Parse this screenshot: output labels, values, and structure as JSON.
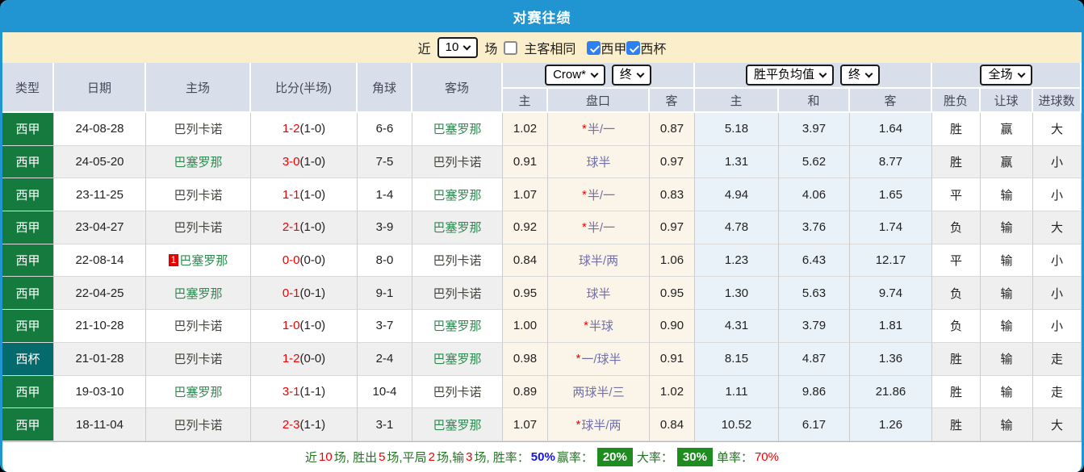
{
  "title": "对赛往绩",
  "colors": {
    "titlebar": "#2095d2",
    "filterbar": "#fbeecb",
    "league_badge": "#147a3d",
    "cup_badge": "#046a6c",
    "checked_checkbox": "#2d7ff2",
    "summary_badge": "#1f8c1f",
    "avg_bg": "#e8f2f8",
    "odds_bg": "#fbf4e8"
  },
  "filter": {
    "near_label": "近",
    "count_value": "10",
    "games_label": "场",
    "same_venue_label": "主客相同",
    "same_venue_checked": false,
    "league_label": "西甲",
    "league_checked": true,
    "cup_label": "西杯",
    "cup_checked": true
  },
  "header": {
    "type": "类型",
    "date": "日期",
    "home": "主场",
    "score": "比分(半场)",
    "corner": "角球",
    "away": "客场",
    "odds_source_select": "Crow*",
    "odds_final_select": "终",
    "avg_select": "胜平负均值",
    "avg_final_select": "终",
    "scope_select": "全场",
    "sub": [
      "主",
      "盘口",
      "客",
      "主",
      "和",
      "客",
      "胜负",
      "让球",
      "进球数"
    ]
  },
  "rows": [
    {
      "type": "西甲",
      "tcls": "league",
      "date": "24-08-28",
      "home": "巴列卡诺",
      "homeGreen": false,
      "badge": "",
      "score": "1-2",
      "half": "(1-0)",
      "corner": "6-6",
      "away": "巴塞罗那",
      "awayGreen": true,
      "oddsHome": "1.02",
      "star": true,
      "handicap": "半/一",
      "oddsAway": "0.87",
      "avgHome": "5.18",
      "avgDraw": "3.97",
      "avgAway": "1.64",
      "result": {
        "t": "胜",
        "c": "red"
      },
      "hcRes": {
        "t": "赢",
        "c": "red2"
      },
      "goals": {
        "t": "大",
        "c": "red2"
      }
    },
    {
      "type": "西甲",
      "tcls": "league",
      "date": "24-05-20",
      "home": "巴塞罗那",
      "homeGreen": true,
      "badge": "",
      "score": "3-0",
      "half": "(1-0)",
      "corner": "7-5",
      "away": "巴列卡诺",
      "awayGreen": false,
      "oddsHome": "0.91",
      "star": false,
      "handicap": "球半",
      "oddsAway": "0.97",
      "avgHome": "1.31",
      "avgDraw": "5.62",
      "avgAway": "8.77",
      "result": {
        "t": "胜",
        "c": "red"
      },
      "hcRes": {
        "t": "赢",
        "c": "red2"
      },
      "goals": {
        "t": "小",
        "c": "green"
      }
    },
    {
      "type": "西甲",
      "tcls": "league",
      "date": "23-11-25",
      "home": "巴列卡诺",
      "homeGreen": false,
      "badge": "",
      "score": "1-1",
      "half": "(1-0)",
      "corner": "1-4",
      "away": "巴塞罗那",
      "awayGreen": true,
      "oddsHome": "1.07",
      "star": true,
      "handicap": "半/一",
      "oddsAway": "0.83",
      "avgHome": "4.94",
      "avgDraw": "4.06",
      "avgAway": "1.65",
      "result": {
        "t": "平",
        "c": "blue"
      },
      "hcRes": {
        "t": "输",
        "c": "green"
      },
      "goals": {
        "t": "小",
        "c": "green"
      }
    },
    {
      "type": "西甲",
      "tcls": "league",
      "date": "23-04-27",
      "home": "巴列卡诺",
      "homeGreen": false,
      "badge": "",
      "score": "2-1",
      "half": "(1-0)",
      "corner": "3-9",
      "away": "巴塞罗那",
      "awayGreen": true,
      "oddsHome": "0.92",
      "star": true,
      "handicap": "半/一",
      "oddsAway": "0.97",
      "avgHome": "4.78",
      "avgDraw": "3.76",
      "avgAway": "1.74",
      "result": {
        "t": "负",
        "c": "green"
      },
      "hcRes": {
        "t": "输",
        "c": "green"
      },
      "goals": {
        "t": "大",
        "c": "red2"
      }
    },
    {
      "type": "西甲",
      "tcls": "league",
      "date": "22-08-14",
      "home": "巴塞罗那",
      "homeGreen": true,
      "badge": "1",
      "score": "0-0",
      "half": "(0-0)",
      "corner": "8-0",
      "away": "巴列卡诺",
      "awayGreen": false,
      "oddsHome": "0.84",
      "star": false,
      "handicap": "球半/两",
      "oddsAway": "1.06",
      "avgHome": "1.23",
      "avgDraw": "6.43",
      "avgAway": "12.17",
      "result": {
        "t": "平",
        "c": "blue"
      },
      "hcRes": {
        "t": "输",
        "c": "green"
      },
      "goals": {
        "t": "小",
        "c": "green"
      }
    },
    {
      "type": "西甲",
      "tcls": "league",
      "date": "22-04-25",
      "home": "巴塞罗那",
      "homeGreen": true,
      "badge": "",
      "score": "0-1",
      "half": "(0-1)",
      "corner": "9-1",
      "away": "巴列卡诺",
      "awayGreen": false,
      "oddsHome": "0.95",
      "star": false,
      "handicap": "球半",
      "oddsAway": "0.95",
      "avgHome": "1.30",
      "avgDraw": "5.63",
      "avgAway": "9.74",
      "result": {
        "t": "负",
        "c": "green"
      },
      "hcRes": {
        "t": "输",
        "c": "green"
      },
      "goals": {
        "t": "小",
        "c": "green"
      }
    },
    {
      "type": "西甲",
      "tcls": "league",
      "date": "21-10-28",
      "home": "巴列卡诺",
      "homeGreen": false,
      "badge": "",
      "score": "1-0",
      "half": "(1-0)",
      "corner": "3-7",
      "away": "巴塞罗那",
      "awayGreen": true,
      "oddsHome": "1.00",
      "star": true,
      "handicap": "半球",
      "oddsAway": "0.90",
      "avgHome": "4.31",
      "avgDraw": "3.79",
      "avgAway": "1.81",
      "result": {
        "t": "负",
        "c": "green"
      },
      "hcRes": {
        "t": "输",
        "c": "green"
      },
      "goals": {
        "t": "小",
        "c": "green"
      }
    },
    {
      "type": "西杯",
      "tcls": "cup",
      "date": "21-01-28",
      "home": "巴列卡诺",
      "homeGreen": false,
      "badge": "",
      "score": "1-2",
      "half": "(0-0)",
      "corner": "2-4",
      "away": "巴塞罗那",
      "awayGreen": true,
      "oddsHome": "0.98",
      "star": true,
      "handicap": "一/球半",
      "oddsAway": "0.91",
      "avgHome": "8.15",
      "avgDraw": "4.87",
      "avgAway": "1.36",
      "result": {
        "t": "胜",
        "c": "red"
      },
      "hcRes": {
        "t": "输",
        "c": "green"
      },
      "goals": {
        "t": "走",
        "c": "blue"
      }
    },
    {
      "type": "西甲",
      "tcls": "league",
      "date": "19-03-10",
      "home": "巴塞罗那",
      "homeGreen": true,
      "badge": "",
      "score": "3-1",
      "half": "(1-1)",
      "corner": "10-4",
      "away": "巴列卡诺",
      "awayGreen": false,
      "oddsHome": "0.89",
      "star": false,
      "handicap": "两球半/三",
      "oddsAway": "1.02",
      "avgHome": "1.11",
      "avgDraw": "9.86",
      "avgAway": "21.86",
      "result": {
        "t": "胜",
        "c": "red"
      },
      "hcRes": {
        "t": "输",
        "c": "green"
      },
      "goals": {
        "t": "走",
        "c": "blue"
      }
    },
    {
      "type": "西甲",
      "tcls": "league",
      "date": "18-11-04",
      "home": "巴列卡诺",
      "homeGreen": false,
      "badge": "",
      "score": "2-3",
      "half": "(1-1)",
      "corner": "3-1",
      "away": "巴塞罗那",
      "awayGreen": true,
      "oddsHome": "1.07",
      "star": true,
      "handicap": "球半/两",
      "oddsAway": "0.84",
      "avgHome": "10.52",
      "avgDraw": "6.17",
      "avgAway": "1.26",
      "result": {
        "t": "胜",
        "c": "red"
      },
      "hcRes": {
        "t": "输",
        "c": "green"
      },
      "goals": {
        "t": "大",
        "c": "red2"
      }
    }
  ],
  "summary": [
    {
      "t": "近 ",
      "c": "green"
    },
    {
      "t": "10",
      "c": "red"
    },
    {
      "t": " 场, 胜出 ",
      "c": "green"
    },
    {
      "t": "5",
      "c": "red"
    },
    {
      "t": " 场,平局 ",
      "c": "green"
    },
    {
      "t": "2",
      "c": "red"
    },
    {
      "t": " 场,输 ",
      "c": "green"
    },
    {
      "t": "3",
      "c": "red"
    },
    {
      "t": " 场, 胜率：",
      "c": "green"
    },
    {
      "t": "50%",
      "c": "blue"
    },
    {
      "t": " 赢率：",
      "c": "green"
    },
    {
      "t": "20%",
      "c": "badge"
    },
    {
      "t": " 大率：",
      "c": "green"
    },
    {
      "t": "30%",
      "c": "badge"
    },
    {
      "t": " 单率：",
      "c": "green"
    },
    {
      "t": "70%",
      "c": "red"
    }
  ]
}
